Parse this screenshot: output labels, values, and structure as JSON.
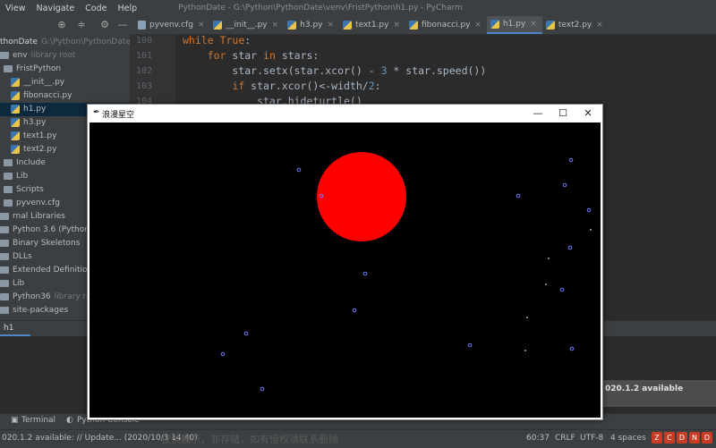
{
  "ide": {
    "menus": [
      "View",
      "Navigate",
      "Code",
      "Help"
    ],
    "title": "PythonDate - G:\\Python\\PythonDate\\venv\\FristPython\\h1.py - PyCharm",
    "tabs": [
      {
        "label": "pyvenv.cfg",
        "type": "cfg"
      },
      {
        "label": "__init__.py",
        "type": "py"
      },
      {
        "label": "h3.py",
        "type": "py"
      },
      {
        "label": "text1.py",
        "type": "py"
      },
      {
        "label": "fibonacci.py",
        "type": "py"
      },
      {
        "label": "h1.py",
        "type": "py",
        "active": true
      },
      {
        "label": "text2.py",
        "type": "py"
      }
    ],
    "project_tree": [
      {
        "label": "thonDate",
        "extra": "G:\\Python\\PythonDate",
        "kind": "root"
      },
      {
        "label": "env",
        "extra": "library root",
        "kind": "folder"
      },
      {
        "label": "FristPython",
        "kind": "folder"
      },
      {
        "label": "__init__.py",
        "kind": "py"
      },
      {
        "label": "fibonacci.py",
        "kind": "py"
      },
      {
        "label": "h1.py",
        "kind": "py",
        "selected": true
      },
      {
        "label": "h3.py",
        "kind": "py"
      },
      {
        "label": "text1.py",
        "kind": "py"
      },
      {
        "label": "text2.py",
        "kind": "py"
      },
      {
        "label": "Include",
        "kind": "folder"
      },
      {
        "label": "Lib",
        "kind": "folder"
      },
      {
        "label": "Scripts",
        "kind": "folder"
      },
      {
        "label": "pyvenv.cfg",
        "kind": "cfg"
      },
      {
        "label": "rnal Libraries",
        "kind": "folder"
      },
      {
        "label": "Python 3.6 (PythonDate",
        "kind": "folder"
      },
      {
        "label": "Binary Skeletons",
        "kind": "folder"
      },
      {
        "label": "DLLs",
        "kind": "folder"
      },
      {
        "label": "Extended Definitions",
        "kind": "folder"
      },
      {
        "label": "Lib",
        "kind": "folder"
      },
      {
        "label": "Python36",
        "extra": "library root",
        "kind": "folder"
      },
      {
        "label": "site-packages",
        "kind": "folder"
      }
    ],
    "code_lines": [
      {
        "num": "100",
        "text": "while True:"
      },
      {
        "num": "101",
        "text": "    for star in stars:"
      },
      {
        "num": "102",
        "text": "        star.setx(star.xcor() - 3 * star.speed())"
      },
      {
        "num": "103",
        "text": "        if star.xcor()<-width/2:"
      },
      {
        "num": "104",
        "text": "            star.hideturtle()"
      }
    ],
    "run_tab": "h1",
    "notification": "020.1.2 available",
    "bottom_tools": [
      "Terminal",
      "Python Console"
    ],
    "status": {
      "message": "020.1.2 available: // Update... (2020/10/3 14:40)",
      "position": "60:37",
      "line_sep": "CRLF",
      "encoding": "UTF-8",
      "indent": "4 spaces"
    },
    "watermark": "仅供展示，非存储，如有侵权请联系删除"
  },
  "turtle_window": {
    "title": "浪漫星空",
    "minimize": "—",
    "maximize": "☐",
    "close": "✕",
    "moon_color": "#ff0000",
    "star_color": "#6b7bff"
  }
}
